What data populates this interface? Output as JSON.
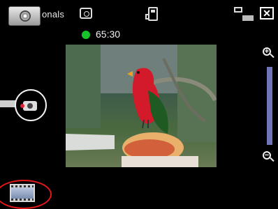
{
  "header": {
    "mode_label": "onals",
    "icons": [
      "camera-tile-icon",
      "scene-mode-icon",
      "memory-card-icon",
      "white-balance-icon",
      "close-icon"
    ],
    "close_glyph": "✕"
  },
  "recording": {
    "status_color": "#18c22a",
    "elapsed": "65:30"
  },
  "viewfinder": {
    "subject": "parrot"
  },
  "zoom": {
    "in_glyph": "+",
    "out_glyph": "−",
    "track_color": "#6f76b6"
  },
  "accents": {
    "highlight_circle": "#f2f2f2",
    "highlight_ring": "#e01818"
  }
}
